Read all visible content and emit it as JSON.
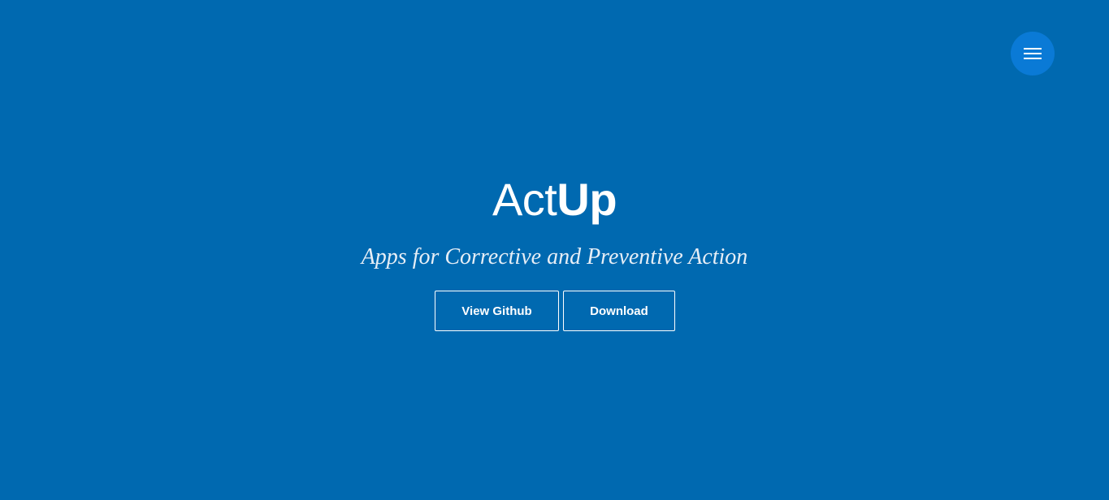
{
  "header": {
    "menu_icon": "hamburger-menu-icon"
  },
  "hero": {
    "brand_light": "Act",
    "brand_bold": "Up",
    "tagline": "Apps for Corrective and Preventive Action"
  },
  "actions": {
    "github_label": "View Github",
    "download_label": "Download"
  },
  "colors": {
    "background": "#0069b0",
    "menu_button": "#0a7ad6",
    "text": "#ffffff"
  }
}
